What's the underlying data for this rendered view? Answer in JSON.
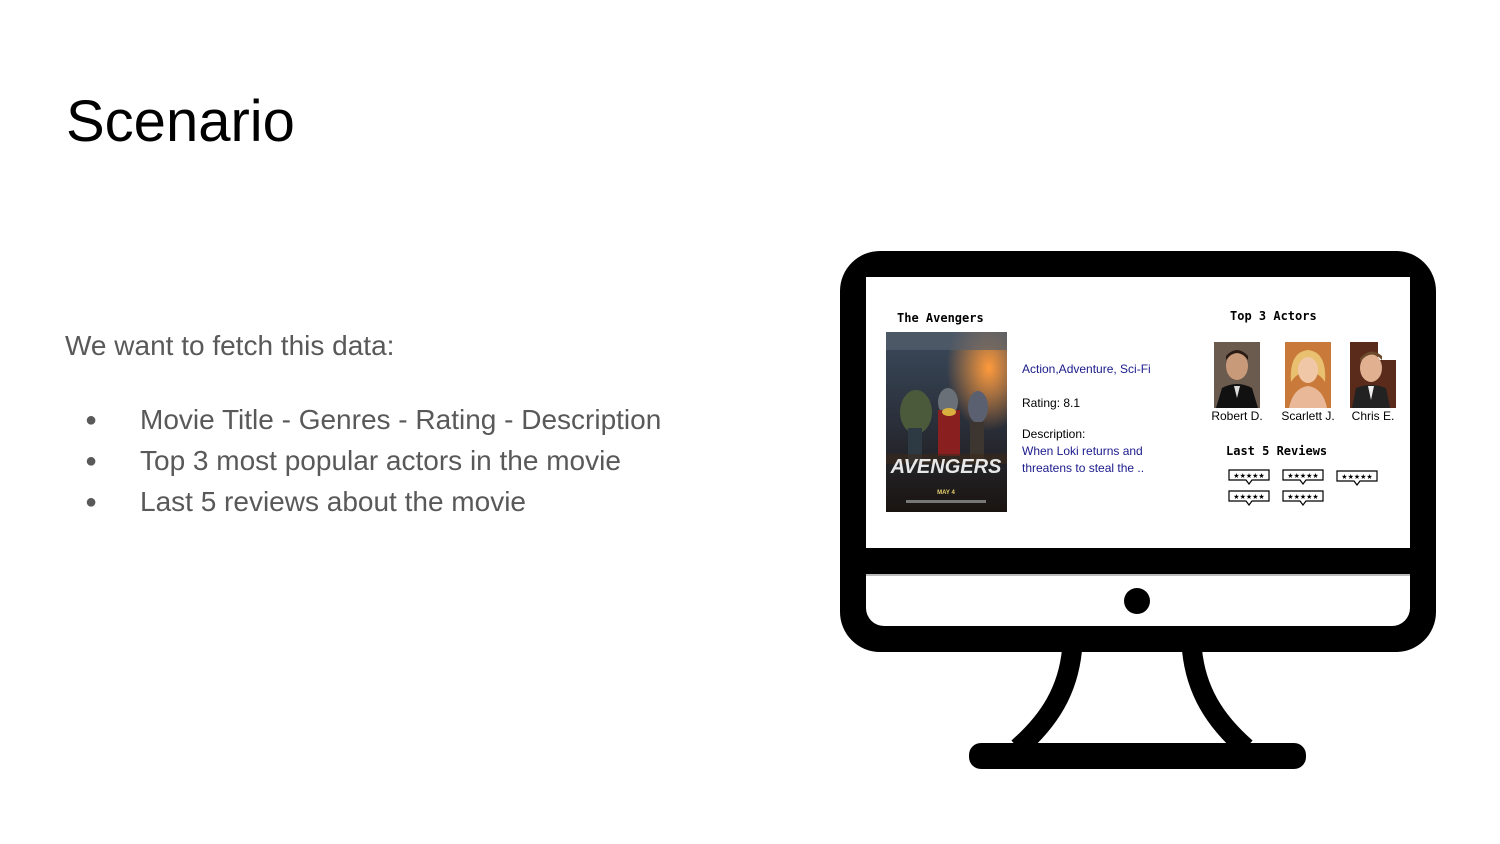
{
  "slide": {
    "title": "Scenario",
    "intro": "We want to fetch this data:",
    "bullets": [
      "Movie Title - Genres - Rating - Description",
      "Top 3 most popular actors in the movie",
      "Last 5 reviews about the movie"
    ]
  },
  "screen": {
    "movie_title": "The Avengers",
    "poster_logo": "AVENGERS",
    "genres": "Action,Adventure, Sci-Fi",
    "rating": "Rating: 8.1",
    "description_label": "Description:",
    "description_line1": "When Loki returns and",
    "description_line2": "threatens to steal the ..",
    "actors_title": "Top 3 Actors",
    "actors": [
      "Robert D.",
      "Scarlett J.",
      "Chris E."
    ],
    "reviews_title": "Last 5 Reviews",
    "review_stars": "★★★★★"
  },
  "colors": {
    "text_gray": "#595959",
    "link_blue": "#1a1a8c",
    "monitor": "#000000"
  }
}
